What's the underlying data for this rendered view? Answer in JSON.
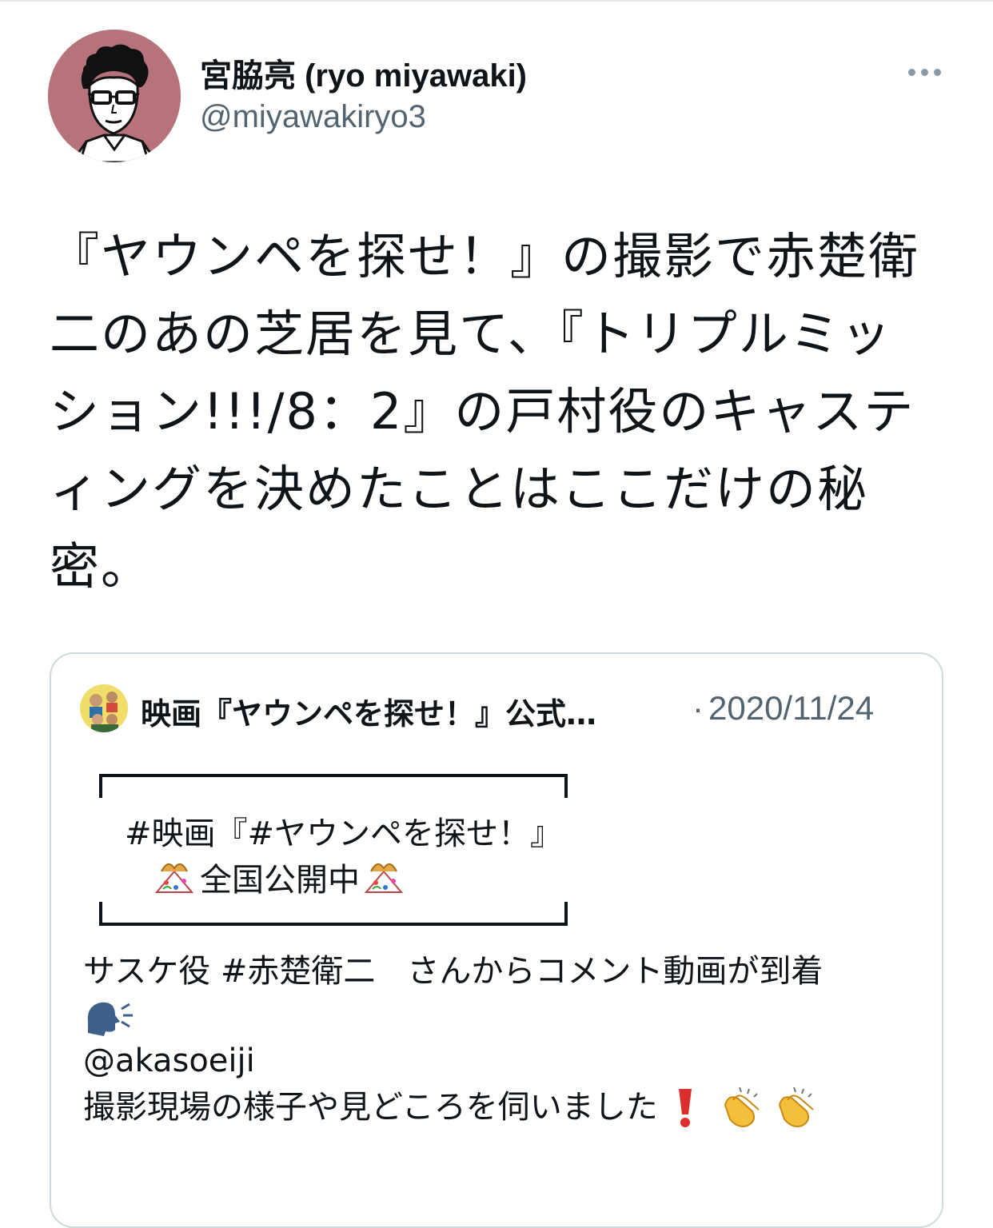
{
  "author": {
    "display_name": "宮脇亮 (ryo miyawaki)",
    "handle": "@miyawakiryo3",
    "avatar_icon": "illustrated-portrait-avatar",
    "avatar_color": "#b7737c"
  },
  "more_icon": "more-horizontal-icon",
  "tweet": {
    "lines": [
      "『ヤウンペを探せ！』の撮影で赤楚衛",
      "二のあの芝居を見て、『トリプルミッ",
      "ション!!!/8：2』の戸村役のキャステ",
      "ィングを決めたことはここだけの秘",
      "密。"
    ]
  },
  "quote": {
    "display_name": "映画『ヤウンペを探せ！』公式…",
    "separator": "·",
    "date": "2020/11/24",
    "frame_line1": "#映画『#ヤウンペを探せ！』",
    "frame_line2": "全国公開中",
    "frame_emoji": "party-popper-icon",
    "text_line1": "サスケ役 #赤楚衛二　さんからコメント動画が到着",
    "text_line2_emoji": "speaking-head-icon",
    "text_line3": "@akasoeiji",
    "text_line4": "撮影現場の様子や見どころを伺いました",
    "text_line4_emojis": [
      "exclamation-icon",
      "clapping-hands-icon",
      "clapping-hands-icon"
    ]
  },
  "colors": {
    "text": "#0f1419",
    "secondary": "#536471",
    "border": "#cfd9de"
  }
}
